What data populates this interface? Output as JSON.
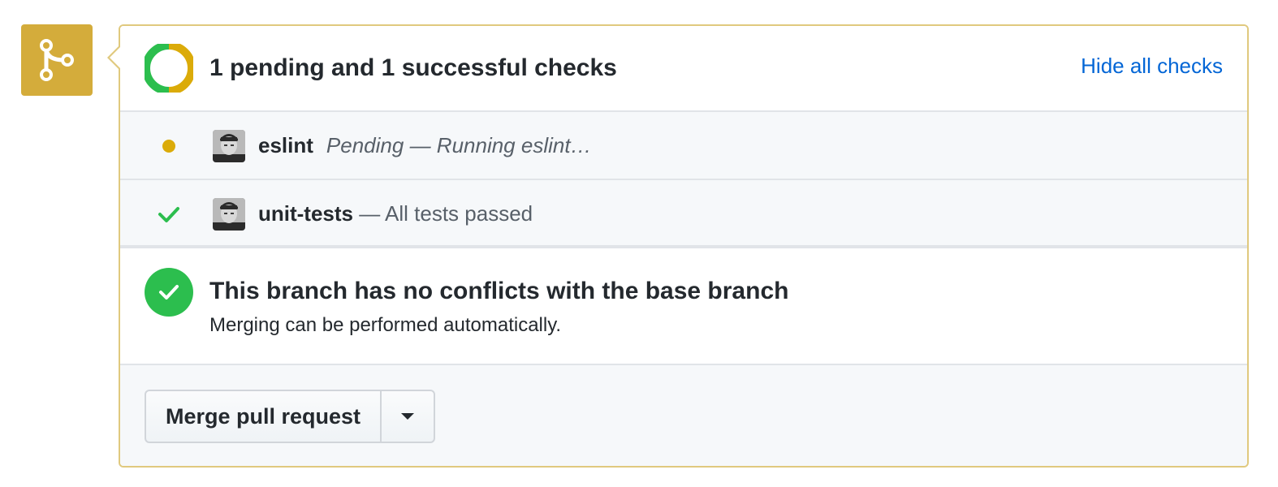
{
  "checks": {
    "title": "1 pending and 1 successful checks",
    "toggle_label": "Hide all checks",
    "items": [
      {
        "name": "eslint",
        "status": "pending",
        "description": "Pending — Running eslint…"
      },
      {
        "name": "unit-tests",
        "status": "success",
        "description": "— All tests passed"
      }
    ]
  },
  "merge_status": {
    "title": "This branch has no conflicts with the base branch",
    "subtitle": "Merging can be performed automatically."
  },
  "actions": {
    "merge_label": "Merge pull request"
  },
  "colors": {
    "pending": "#dbab09",
    "success": "#2cbe4e",
    "link": "#0366d6",
    "merge_icon_bg": "#d4ac3b"
  },
  "icons": {
    "merge_state": "git-merge-icon",
    "checks_summary": "donut-status-icon",
    "pending": "dot-icon",
    "success": "check-icon",
    "dropdown": "triangle-down-icon"
  }
}
